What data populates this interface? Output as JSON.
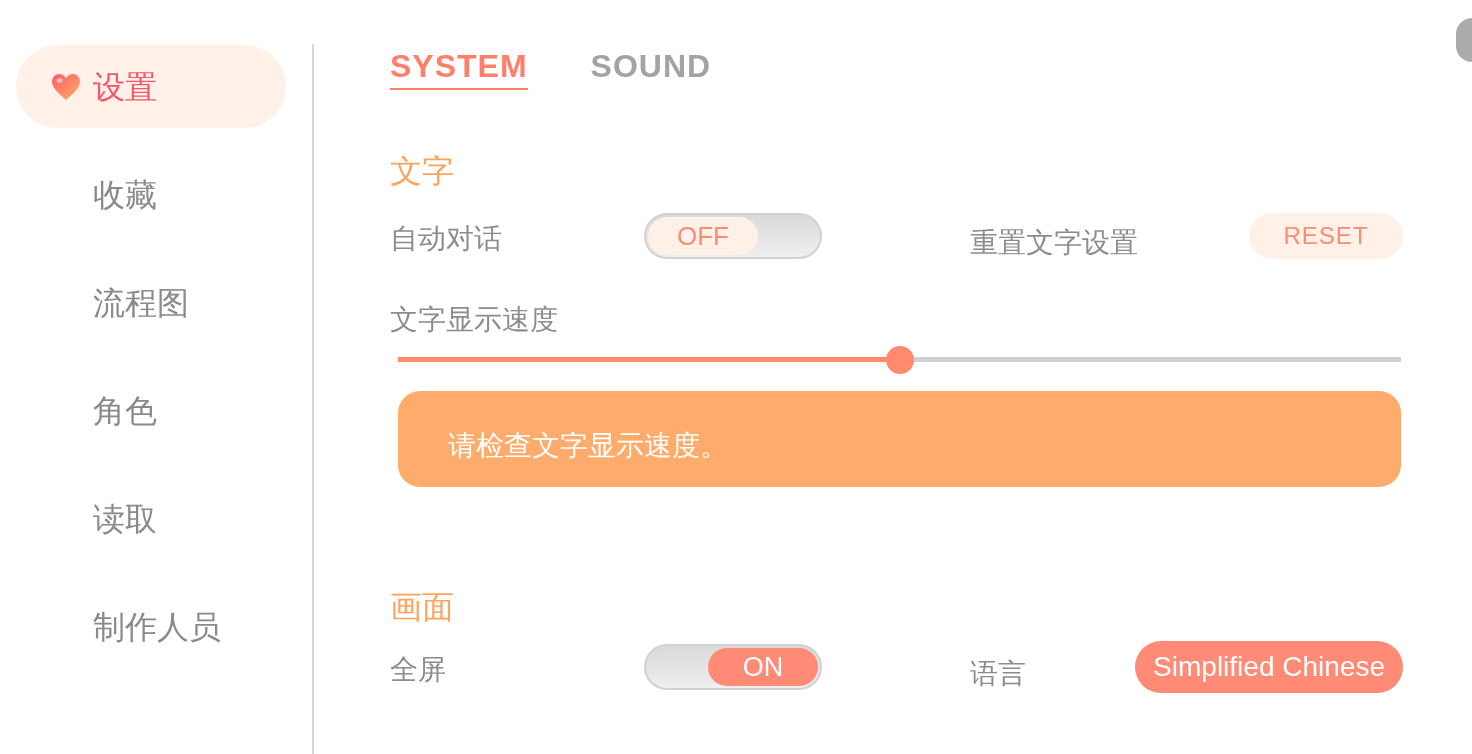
{
  "sidebar": {
    "items": [
      {
        "label": "设置",
        "selected": true
      },
      {
        "label": "收藏",
        "selected": false
      },
      {
        "label": "流程图",
        "selected": false
      },
      {
        "label": "角色",
        "selected": false
      },
      {
        "label": "读取",
        "selected": false
      },
      {
        "label": "制作人员",
        "selected": false
      }
    ]
  },
  "tabs": [
    {
      "label": "SYSTEM",
      "selected": true
    },
    {
      "label": "SOUND",
      "selected": false
    }
  ],
  "sections": [
    {
      "title": "文字",
      "rows": [
        {
          "items": [
            {
              "kind": "toggle",
              "label": "自动对话",
              "on": false,
              "state_label": "OFF"
            },
            {
              "kind": "action",
              "label": "重置文字设置",
              "button": "RESET"
            }
          ]
        },
        {
          "items": [
            {
              "kind": "slider",
              "label": "文字显示速度",
              "level": 0.5
            }
          ]
        },
        {
          "items": [
            {
              "kind": "message",
              "text": "请检查文字显示速度。"
            }
          ]
        }
      ]
    },
    {
      "title": "画面",
      "rows": [
        {
          "items": [
            {
              "kind": "toggle",
              "label": "全屏",
              "on": true,
              "state_label": "ON"
            },
            {
              "kind": "choice",
              "label": "语言",
              "value": "Simplified Chinese"
            }
          ]
        }
      ]
    }
  ]
}
